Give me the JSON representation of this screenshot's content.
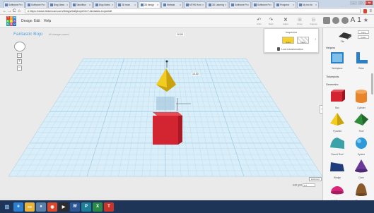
{
  "browser": {
    "tabs": [
      {
        "title": "Softhome Poc",
        "active": false
      },
      {
        "title": "Softhome Poc",
        "active": false
      },
      {
        "title": "Bing News",
        "active": false
      },
      {
        "title": "Tatrolfiton",
        "active": false
      },
      {
        "title": "Blog Notes",
        "active": false
      },
      {
        "title": "3D mom",
        "active": false
      },
      {
        "title": "3D design",
        "active": true
      },
      {
        "title": "Website",
        "active": false
      },
      {
        "title": "MTHS Hom",
        "active": false
      },
      {
        "title": "3D Learning",
        "active": false
      },
      {
        "title": "Softhome Poc",
        "active": false
      },
      {
        "title": "Softhome Poc",
        "active": false
      },
      {
        "title": "Prospens",
        "active": false
      },
      {
        "title": "My rec for",
        "active": false
      }
    ],
    "url": "https://www.tinkercad.com/things/6dhjLkyelCbT-fantastic-bojo/edit",
    "tab_close": "x",
    "win_min": "–",
    "win_max": "□",
    "win_close": "x",
    "back": "←",
    "forward": "→",
    "reload": "C",
    "home": "⌂",
    "menu": "≡"
  },
  "app": {
    "logo_letters": [
      "T",
      "I",
      "N",
      "K",
      "E",
      "R",
      "C",
      "A",
      "D"
    ],
    "logo_colors": [
      "#e23b2b",
      "#f19b2c",
      "#2d8fd0",
      "#3bb44a",
      "#f0c419",
      "#6d4aa5",
      "#2aa6a0",
      "#e6497a",
      "#1e6fb6"
    ],
    "menu": [
      "Design",
      "Edit",
      "Help"
    ],
    "tools": [
      {
        "icon": "↶",
        "label": "Undo"
      },
      {
        "icon": "↷",
        "label": "Redo"
      },
      {
        "icon": "✕",
        "label": "Adjust"
      },
      {
        "icon": "⊞",
        "label": "Group"
      },
      {
        "icon": "⊟",
        "label": "Ungroup"
      }
    ],
    "right_icon": "A",
    "right_num": "1",
    "star": "★"
  },
  "canvas": {
    "design_title": "Fantastic Bojo",
    "status": "All changes saved",
    "home_view": "⌂",
    "zoom_in": "+",
    "zoom_out": "−",
    "dim_top": "10.00",
    "dim_mid": "10.00",
    "edit_grid_button": "Edit Grid",
    "edit_grid_label": "Edit grid",
    "edit_grid_value": "1.0",
    "colors": {
      "grid_bg": "#d9eef8",
      "grid_line": "#9ccbe5",
      "cube_front": "#d32431",
      "cube_top": "#e94b55",
      "cube_side": "#a81b26",
      "pyramid": "#f2cc1e",
      "pyramid_dark": "#c9a20e",
      "hole": "#9ec3d8"
    }
  },
  "inspector": {
    "title": "Inspector",
    "solid_label": "Solid",
    "hole_label": "Hole",
    "lock_label": "Lock transformation",
    "close": "›"
  },
  "panel": {
    "top_label": "File",
    "copy_btn": "Copy",
    "paste_btn": "Paste",
    "sections": {
      "helpers": "Helpers",
      "tinkerplots": "Tinkerplots",
      "geometric": "Geometric"
    },
    "helpers": [
      {
        "label": "Workplane"
      },
      {
        "label": "Ruler"
      }
    ],
    "geometric": [
      {
        "label": "Box",
        "color": "#d32431",
        "shape": "box"
      },
      {
        "label": "Cylinder",
        "color": "#e8842a",
        "shape": "cyl"
      },
      {
        "label": "Pyramid",
        "color": "#f2cc1e",
        "shape": "pyr"
      },
      {
        "label": "Roof",
        "color": "#2e8b3a",
        "shape": "roof"
      },
      {
        "label": "Round Roof",
        "color": "#3aa2a8",
        "shape": "rroof"
      },
      {
        "label": "Sphere",
        "color": "#2c9ad8",
        "shape": "sph"
      },
      {
        "label": "Wedge",
        "color": "#1f3d7a",
        "shape": "wedge"
      },
      {
        "label": "Cone",
        "color": "#6a3a9a",
        "shape": "cone"
      },
      {
        "label": "Half Sphere",
        "color": "#d8267a",
        "shape": "half"
      },
      {
        "label": "Paraboloid",
        "color": "#8a5a2a",
        "shape": "para"
      }
    ],
    "collapse": "›"
  },
  "taskbar": {
    "apps": [
      {
        "name": "Start",
        "glyph": "⊞",
        "color": "#2a5ea8"
      },
      {
        "name": "Internet Explorer",
        "glyph": "e",
        "color": "#2a7fd0"
      },
      {
        "name": "File Explorer",
        "glyph": "▭",
        "color": "#e8b43a"
      },
      {
        "name": "Paint",
        "glyph": "●",
        "color": "#5a7fa8"
      },
      {
        "name": "Chrome",
        "glyph": "◉",
        "color": "#d9482b"
      },
      {
        "name": "Media",
        "glyph": "▶",
        "color": "#2c2c2c"
      },
      {
        "name": "Word",
        "glyph": "W",
        "color": "#2b5797"
      },
      {
        "name": "Publisher",
        "glyph": "P",
        "color": "#1e7f9a"
      },
      {
        "name": "Excel",
        "glyph": "X",
        "color": "#2a8a4a"
      },
      {
        "name": "Tinkercad",
        "glyph": "T",
        "color": "#c8342a"
      }
    ],
    "time": "2:22 PM",
    "date": "4/4/2017",
    "tray_icons": "▴ ⚑ ▯ ◂)"
  }
}
